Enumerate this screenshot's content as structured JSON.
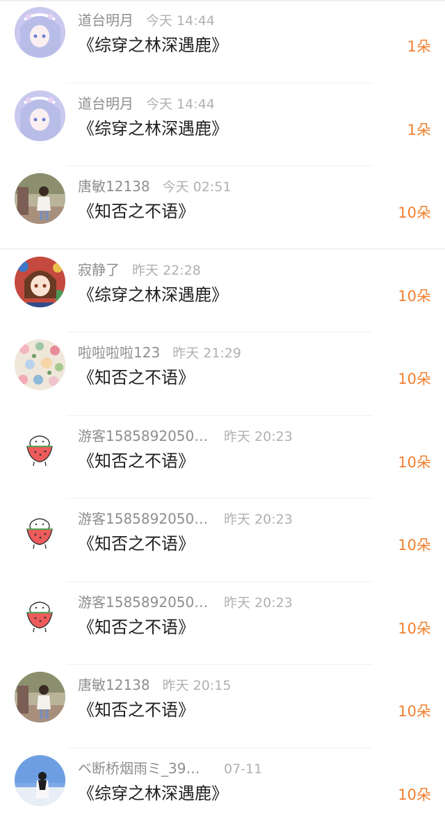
{
  "colors": {
    "count_accent": "#f08030",
    "name_gray": "#8e8e8e",
    "time_gray": "#b0b0b0",
    "divider": "#f0f0f0"
  },
  "rows": [
    {
      "name": "道台明月",
      "time": "今天 14:44",
      "book": "《综穿之林深遇鹿》",
      "count": "1朵",
      "avatar": "anime-girl-blue"
    },
    {
      "name": "道台明月",
      "time": "今天 14:44",
      "book": "《综穿之林深遇鹿》",
      "count": "1朵",
      "avatar": "anime-girl-blue"
    },
    {
      "name": "唐敏12138",
      "time": "今天 02:51",
      "book": "《知否之不语》",
      "count": "10朵",
      "avatar": "photo-person-outdoor"
    },
    {
      "name": "寂静了",
      "time": "昨天 22:28",
      "book": "《综穿之林深遇鹿》",
      "count": "10朵",
      "avatar": "anime-girl-red"
    },
    {
      "name": "啦啦啦啦123",
      "time": "昨天 21:29",
      "book": "《知否之不语》",
      "count": "10朵",
      "avatar": "floral-pattern"
    },
    {
      "name": "游客1585892050…",
      "time": "昨天 20:23",
      "book": "《知否之不语》",
      "count": "10朵",
      "avatar": "cartoon-watermelon"
    },
    {
      "name": "游客1585892050…",
      "time": "昨天 20:23",
      "book": "《知否之不语》",
      "count": "10朵",
      "avatar": "cartoon-watermelon"
    },
    {
      "name": "游客1585892050…",
      "time": "昨天 20:23",
      "book": "《知否之不语》",
      "count": "10朵",
      "avatar": "cartoon-watermelon"
    },
    {
      "name": "唐敏12138",
      "time": "昨天 20:15",
      "book": "《知否之不语》",
      "count": "10朵",
      "avatar": "photo-person-outdoor"
    },
    {
      "name": "ベ断桥烟雨ミ_39…",
      "time": "07-11",
      "book": "《综穿之林深遇鹿》",
      "count": "10朵",
      "avatar": "photo-person-sky"
    }
  ]
}
